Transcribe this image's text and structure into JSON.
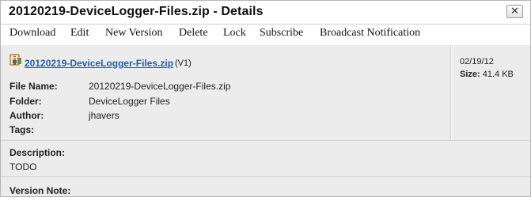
{
  "dialog": {
    "title": "20120219-DeviceLogger-Files.zip - Details",
    "close_label": "✕"
  },
  "toolbar": {
    "items": [
      "Download",
      "Edit",
      "New Version",
      "Delete",
      "Lock",
      "Subscribe",
      "Broadcast Notification"
    ]
  },
  "file": {
    "name_link": "20120219-DeviceLogger-Files.zip",
    "version": "(V1)",
    "icon": "zip-file-icon"
  },
  "details": {
    "file_name_label": "File Name:",
    "file_name": "20120219-DeviceLogger-Files.zip",
    "folder_label": "Folder:",
    "folder": "DeviceLogger Files",
    "author_label": "Author:",
    "author": "jhavers",
    "tags_label": "Tags:",
    "tags": ""
  },
  "meta": {
    "date": "02/19/12",
    "size_label": "Size:",
    "size": "41.4 KB"
  },
  "description": {
    "label": "Description:",
    "value": "TODO"
  },
  "version_note": {
    "label": "Version Note:"
  },
  "colors": {
    "link": "#1a5fb4",
    "panel_bg": "#ececec"
  }
}
